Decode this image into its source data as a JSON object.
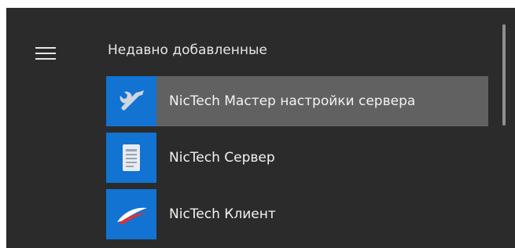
{
  "start_menu": {
    "section_title": "Недавно добавленные",
    "items": [
      {
        "label": "NicTech Мастер настройки сервера",
        "icon": "wrench-icon",
        "selected": true
      },
      {
        "label": "NicTech Сервер",
        "icon": "document-icon",
        "selected": false
      },
      {
        "label": "NicTech Клиент",
        "icon": "flag-icon",
        "selected": false
      }
    ]
  },
  "colors": {
    "menu_background": "#2b2b2b",
    "selected_row": "#616161",
    "tile": "#1273d2",
    "text": "#f2f2f2",
    "scrollbar": "#8f8f8f"
  }
}
